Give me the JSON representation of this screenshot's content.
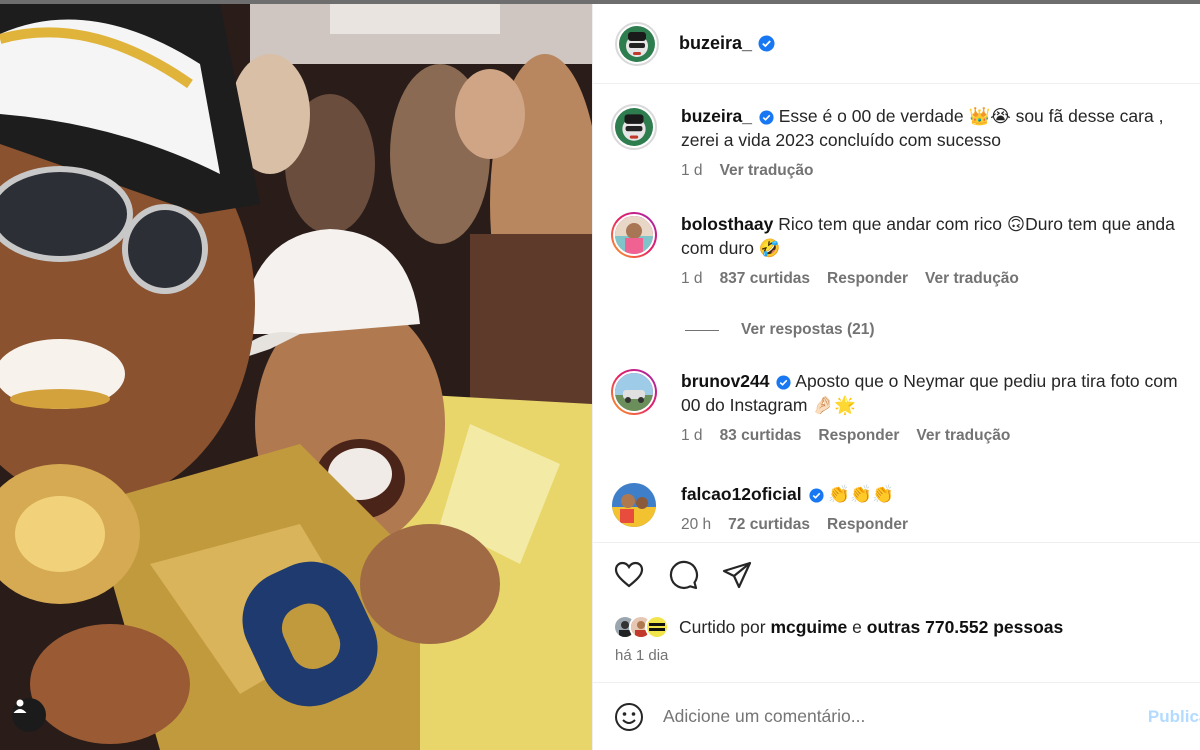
{
  "colors": {
    "accent": "#0095f6",
    "verified": "#1877f2",
    "muted": "#737373",
    "post_disabled": "#b3dbff"
  },
  "post": {
    "author": "buzeira_",
    "avatar_icon": "profile-avatar-icon"
  },
  "comments": [
    {
      "username": "buzeira_",
      "verified": true,
      "text": "Esse é o 00 de verdade 👑😭 sou fã desse cara , zerei a vida 2023 concluído com sucesso",
      "time": "1 d",
      "translate": "Ver tradução"
    },
    {
      "username": "bolosthaay",
      "verified": false,
      "text": "Rico tem que andar com rico 🙃Duro tem que anda com duro 🤣",
      "time": "1 d",
      "likes": "837 curtidas",
      "reply": "Responder",
      "translate": "Ver tradução",
      "view_replies": "Ver respostas (21)"
    },
    {
      "username": "brunov244",
      "verified": true,
      "text": "Aposto que o Neymar que pediu pra tira foto com 00 do Instagram 🤌🏻🌟",
      "time": "1 d",
      "likes": "83 curtidas",
      "reply": "Responder",
      "translate": "Ver tradução"
    },
    {
      "username": "falcao12oficial",
      "verified": true,
      "text": "👏👏👏",
      "time": "20 h",
      "likes": "72 curtidas",
      "reply": "Responder"
    }
  ],
  "actions": {
    "like_icon": "heart-icon",
    "comment_icon": "comment-icon",
    "share_icon": "share-icon",
    "liked_by_prefix": "Curtido por",
    "liked_by_user": "mcguime",
    "liked_by_conj": "e",
    "liked_by_others": "outras 770.552 pessoas",
    "date": "há 1 dia"
  },
  "add_comment": {
    "placeholder": "Adicione um comentário...",
    "post_label": "Publicar"
  }
}
